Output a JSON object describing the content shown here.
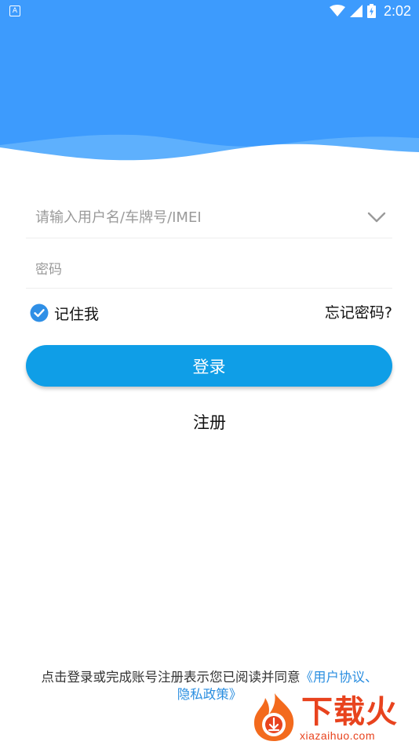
{
  "status_bar": {
    "app_icon_letter": "A",
    "time": "2:02",
    "icons": [
      "wifi-icon",
      "cell-signal-icon",
      "battery-charging-icon"
    ]
  },
  "login_form": {
    "username_placeholder": "请输入用户名/车牌号/IMEI",
    "password_placeholder": "密码",
    "remember_label": "记住我",
    "remember_checked": true,
    "forgot_label": "忘记密码?",
    "login_label": "登录",
    "register_label": "注册"
  },
  "agreement": {
    "prefix": "点击登录或完成账号注册表示您已阅读并同意",
    "link_line1": "《用户协议、",
    "link_line2": "隐私政策》"
  },
  "watermark": {
    "brand": "下载火",
    "url": "xiazaihuo.com"
  },
  "colors": {
    "header_blue": "#3d9bfd",
    "wave_light": "#5eb0fd",
    "button_blue": "#0f9ee7",
    "link_blue": "#2a8ee0",
    "checkbox_blue": "#2f8fe6",
    "watermark_red": "#e8431e"
  }
}
